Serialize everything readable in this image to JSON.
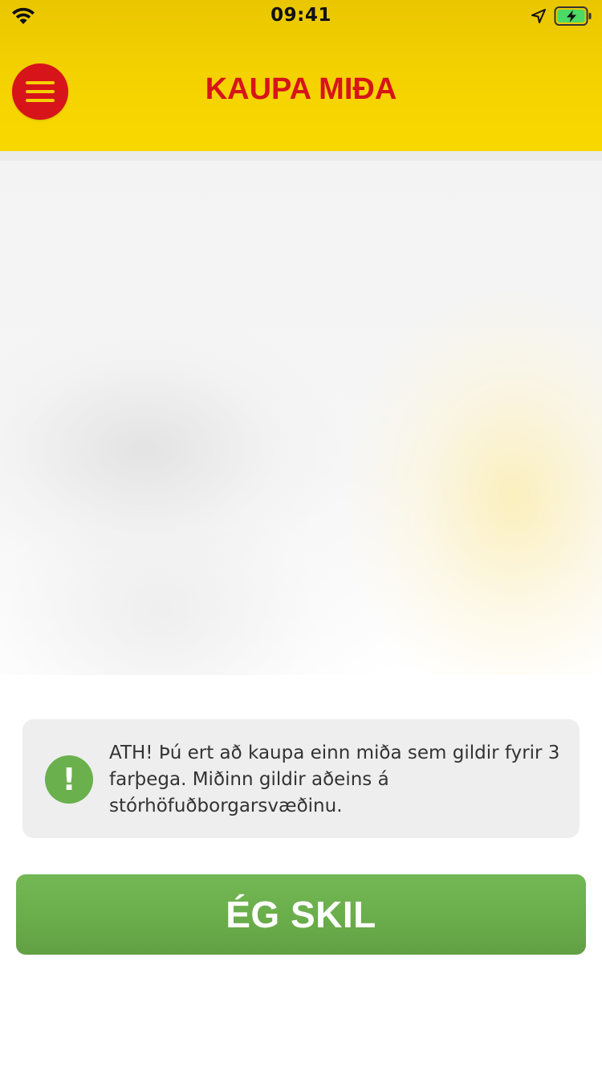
{
  "status_bar": {
    "time": "09:41",
    "wifi_icon": "wifi-icon",
    "location_icon": "location-arrow-icon",
    "battery_icon": "battery-charging-icon"
  },
  "header": {
    "title": "KAUPA MIÐA",
    "menu_icon": "hamburger-menu-icon",
    "colors": {
      "background": "#f4d200",
      "title": "#d7141a",
      "menu_button": "#d7141a"
    }
  },
  "notice": {
    "icon": "exclamation-icon",
    "text": "ATH! Þú ert að kaupa einn miða sem gildir fyrir 3 farþega. Miðinn gildir aðeins á stórhöfuðborgarsvæðinu.",
    "colors": {
      "icon": "#6ab04c",
      "background": "#eeeeee"
    }
  },
  "confirm_button": {
    "label": "ÉG SKIL",
    "color": "#6aad4b"
  }
}
